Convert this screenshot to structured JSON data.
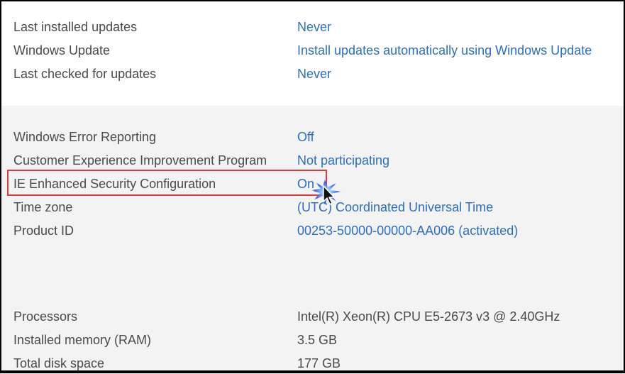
{
  "updates": [
    {
      "label": "Last installed updates",
      "value": "Never"
    },
    {
      "label": "Windows Update",
      "value": "Install updates automatically using Windows Update"
    },
    {
      "label": "Last checked for updates",
      "value": "Never"
    }
  ],
  "settings": [
    {
      "label": "Windows Error Reporting",
      "value": "Off"
    },
    {
      "label": "Customer Experience Improvement Program",
      "value": "Not participating"
    },
    {
      "label": "IE Enhanced Security Configuration",
      "value": "On"
    },
    {
      "label": "Time zone",
      "value": "(UTC) Coordinated Universal Time"
    },
    {
      "label": "Product ID",
      "value": "00253-50000-00000-AA006 (activated)"
    }
  ],
  "hardware": [
    {
      "label": "Processors",
      "value": "Intel(R) Xeon(R) CPU E5-2673 v3 @ 2.40GHz"
    },
    {
      "label": "Installed memory (RAM)",
      "value": "3.5 GB"
    },
    {
      "label": "Total disk space",
      "value": "177 GB"
    }
  ],
  "colors": {
    "link": "#2a6fc0",
    "label": "#4a4a4a",
    "highlight": "#e23a3a",
    "section_bg": "#f3f3f3"
  }
}
